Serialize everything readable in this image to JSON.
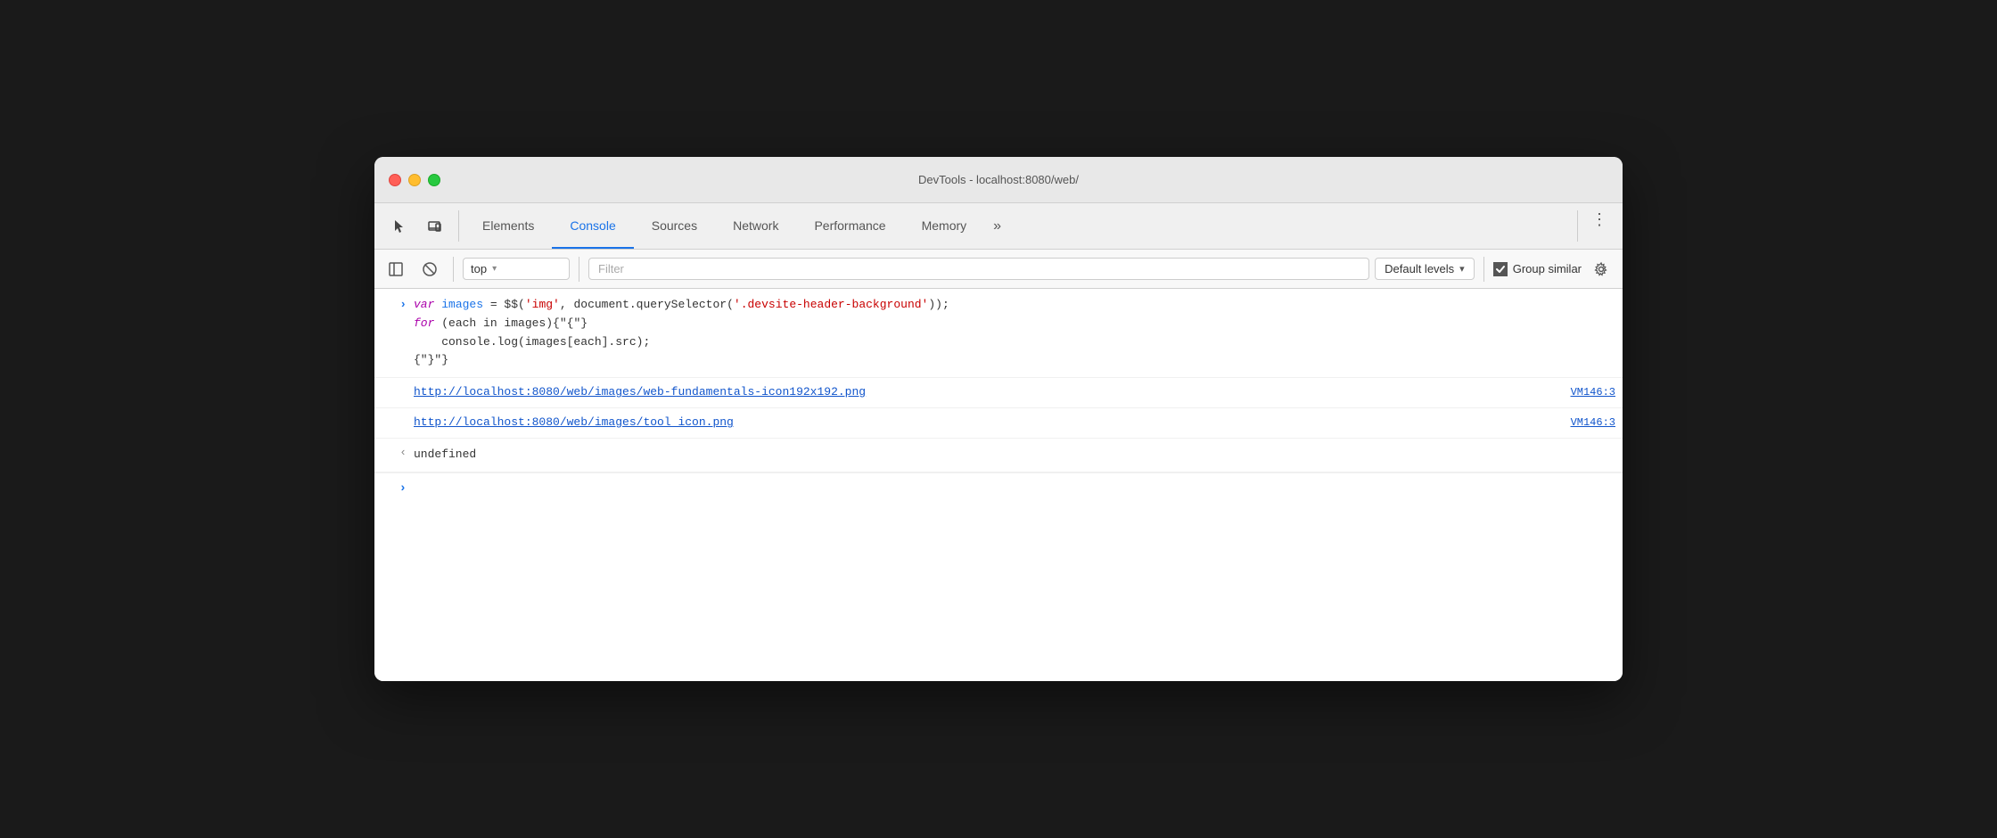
{
  "window": {
    "title": "DevTools - localhost:8080/web/"
  },
  "traffic_lights": {
    "close_label": "close",
    "min_label": "minimize",
    "max_label": "maximize"
  },
  "toolbar": {
    "inspect_icon": "cursor-icon",
    "device_icon": "device-icon",
    "tabs": [
      {
        "id": "elements",
        "label": "Elements",
        "active": false
      },
      {
        "id": "console",
        "label": "Console",
        "active": true
      },
      {
        "id": "sources",
        "label": "Sources",
        "active": false
      },
      {
        "id": "network",
        "label": "Network",
        "active": false
      },
      {
        "id": "performance",
        "label": "Performance",
        "active": false
      },
      {
        "id": "memory",
        "label": "Memory",
        "active": false
      }
    ],
    "more_label": "»",
    "menu_label": "⋮"
  },
  "console_toolbar": {
    "sidebar_icon": "sidebar-icon",
    "clear_icon": "clear-icon",
    "context_label": "top",
    "context_arrow": "▾",
    "filter_placeholder": "Filter",
    "levels_label": "Default levels",
    "levels_arrow": "▾",
    "group_similar_label": "Group similar",
    "settings_icon": "settings-icon"
  },
  "console": {
    "entries": [
      {
        "type": "input",
        "gutter": ">",
        "lines": [
          {
            "parts": [
              {
                "text": "var ",
                "class": "kw-var"
              },
              {
                "text": "images",
                "class": "var-name"
              },
              {
                "text": " = $$(",
                "class": "normal"
              },
              {
                "text": "'img'",
                "class": "str-val"
              },
              {
                "text": ", document.querySelector(",
                "class": "normal"
              },
              {
                "text": "'.devsite-header-background'",
                "class": "str-val"
              },
              {
                "text": "));",
                "class": "normal"
              }
            ]
          },
          {
            "parts": [
              {
                "text": "for ",
                "class": "kw-for"
              },
              {
                "text": "(each in images){",
                "class": "normal"
              }
            ]
          },
          {
            "parts": [
              {
                "text": "    console.log(images[each].src);",
                "class": "normal"
              }
            ]
          },
          {
            "parts": [
              {
                "text": "}",
                "class": "normal"
              }
            ]
          }
        ]
      },
      {
        "type": "output-link",
        "gutter": "",
        "url": "http://localhost:8080/web/images/web-fundamentals-icon192x192.png",
        "source": "VM146:3"
      },
      {
        "type": "output-link",
        "gutter": "",
        "url": "http://localhost:8080/web/images/tool_icon.png",
        "source": "VM146:3"
      },
      {
        "type": "output-undefined",
        "gutter": "‹",
        "value": "undefined"
      }
    ],
    "prompt_arrow": ">"
  }
}
